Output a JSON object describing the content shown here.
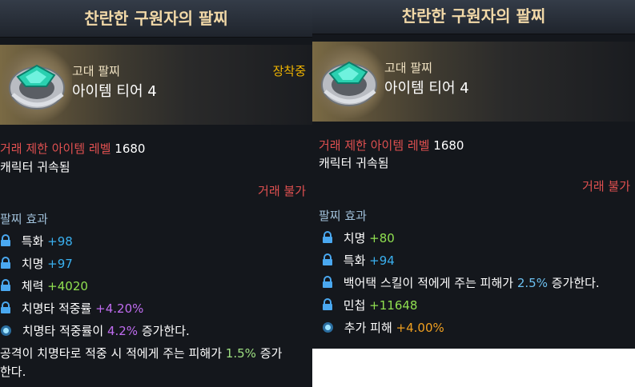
{
  "left": {
    "title": "찬란한 구원자의 팔찌",
    "grade": "고대 팔찌",
    "tier": "아이템 티어 4",
    "equipped": "장착중",
    "trade_label": "거래 제한 아이템 레벨",
    "trade_level": "1680",
    "bound": "캐릭터 귀속됨",
    "no_trade": "거래 불가",
    "section": "팔찌 효과",
    "effects": [
      {
        "label": "특화",
        "value": "+98"
      },
      {
        "label": "치명",
        "value": "+97"
      },
      {
        "label": "체력",
        "value": "+4020"
      },
      {
        "label": "치명타 적중률",
        "value": "+4.20%"
      }
    ],
    "special": {
      "prefix": "치명타 적중률이",
      "value": "4.2%",
      "suffix": "증가한다."
    },
    "desc_line1_prefix": "공격이 치명타로 적중 시 적에게 주는 피해가",
    "desc_line1_value": "1.5%",
    "desc_line1_suffix": "증가",
    "desc_line2": "한다."
  },
  "right": {
    "title": "찬란한 구원자의 팔찌",
    "grade": "고대 팔찌",
    "tier": "아이템 티어 4",
    "trade_label": "거래 제한 아이템 레벨",
    "trade_level": "1680",
    "bound": "캐릭터 귀속됨",
    "no_trade": "거래 불가",
    "section": "팔찌 효과",
    "effects": [
      {
        "label": "치명",
        "value": "+80"
      },
      {
        "label": "특화",
        "value": "+94"
      }
    ],
    "backattack": {
      "prefix": "백어택 스킬이 적에게 주는 피해가",
      "value": "2.5%",
      "suffix": "증가한다."
    },
    "agility": {
      "label": "민첩",
      "value": "+11648"
    },
    "extra": {
      "label": "추가 피해",
      "value": "+4.00%"
    }
  },
  "colors": {
    "panel_bg": "#14171c",
    "title": "#f2d9a8",
    "equipped": "#f0b400",
    "trade_red": "#e05050",
    "stat_blue": "#3ab0f0",
    "stat_green": "#90e050",
    "stat_purple": "#c06cf0",
    "stat_orange": "#f0a020"
  },
  "icons": [
    "lock-icon",
    "gem-icon",
    "bracelet-image"
  ]
}
